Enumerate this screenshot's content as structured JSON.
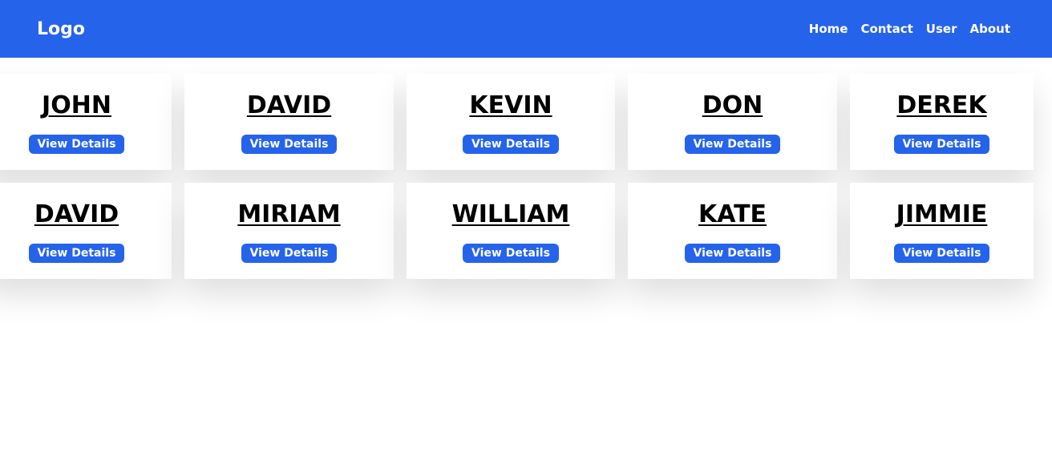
{
  "navbar": {
    "logo": "Logo",
    "links": [
      "Home",
      "Contact",
      "User",
      "About"
    ]
  },
  "cards": [
    {
      "name": "JOHN",
      "button": "View Details"
    },
    {
      "name": "DAVID",
      "button": "View Details"
    },
    {
      "name": "KEVIN",
      "button": "View Details"
    },
    {
      "name": "DON",
      "button": "View Details"
    },
    {
      "name": "DEREK",
      "button": "View Details"
    },
    {
      "name": "DAVID",
      "button": "View Details"
    },
    {
      "name": "MIRIAM",
      "button": "View Details"
    },
    {
      "name": "WILLIAM",
      "button": "View Details"
    },
    {
      "name": "KATE",
      "button": "View Details"
    },
    {
      "name": "JIMMIE",
      "button": "View Details"
    }
  ],
  "colors": {
    "primary": "#2563eb",
    "background": "#ffffff",
    "text": "#000000"
  }
}
